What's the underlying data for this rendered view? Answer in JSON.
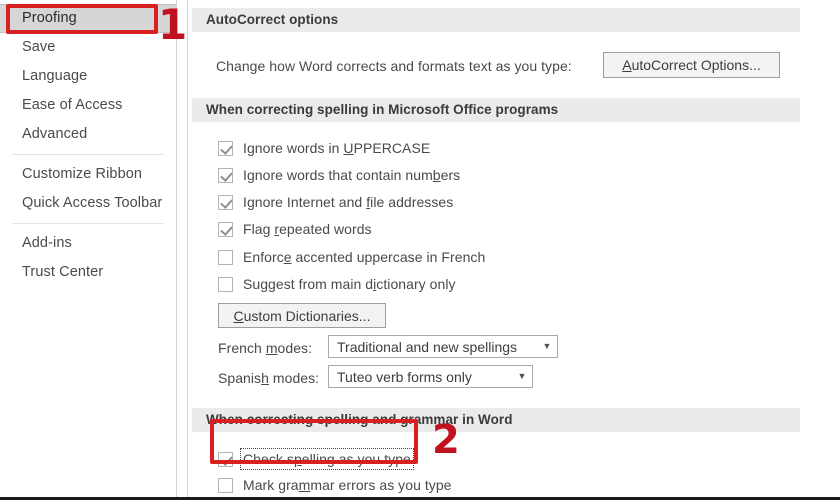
{
  "sidebar": {
    "items": [
      {
        "label": "Proofing",
        "selected": true
      },
      {
        "label": "Save",
        "selected": false
      },
      {
        "label": "Language",
        "selected": false
      },
      {
        "label": "Ease of Access",
        "selected": false
      },
      {
        "label": "Advanced",
        "selected": false
      },
      {
        "label": "Customize Ribbon",
        "selected": false
      },
      {
        "label": "Quick Access Toolbar",
        "selected": false
      },
      {
        "label": "Add-ins",
        "selected": false
      },
      {
        "label": "Trust Center",
        "selected": false
      }
    ]
  },
  "sections": {
    "autocorrect": {
      "header": "AutoCorrect options",
      "description": "Change how Word corrects and formats text as you type:",
      "button_label": "AutoCorrect Options...",
      "button_accelerator": "A"
    },
    "office_spelling": {
      "header": "When correcting spelling in Microsoft Office programs",
      "checkboxes": [
        {
          "label": "Ignore words in UPPERCASE",
          "accelerator": "U",
          "checked": true
        },
        {
          "label": "Ignore words that contain numbers",
          "accelerator": "b",
          "checked": true
        },
        {
          "label": "Ignore Internet and file addresses",
          "accelerator": "f",
          "checked": true
        },
        {
          "label": "Flag repeated words",
          "accelerator": "r",
          "checked": true
        },
        {
          "label": "Enforce accented uppercase in French",
          "accelerator": "e",
          "checked": false
        },
        {
          "label": "Suggest from main dictionary only",
          "accelerator": "i",
          "checked": false
        }
      ],
      "custom_dictionaries_label": "Custom Dictionaries...",
      "custom_dictionaries_accelerator": "C",
      "french_modes_label": "French modes:",
      "french_modes_accelerator": "m",
      "french_modes_value": "Traditional and new spellings",
      "spanish_modes_label": "Spanish modes:",
      "spanish_modes_accelerator": "h",
      "spanish_modes_value": "Tuteo verb forms only",
      "caret_icon": "chevron-down-icon"
    },
    "word_spelling": {
      "header": "When correcting spelling and grammar in Word",
      "checkboxes": [
        {
          "label": "Check spelling as you type",
          "accelerator": "p",
          "checked": true,
          "focused": true
        },
        {
          "label": "Mark grammar errors as you type",
          "accelerator": "m",
          "checked": false,
          "focused": false
        }
      ]
    }
  },
  "annotations": {
    "marker_one": "1",
    "marker_two": "2",
    "color": "#d92020"
  }
}
